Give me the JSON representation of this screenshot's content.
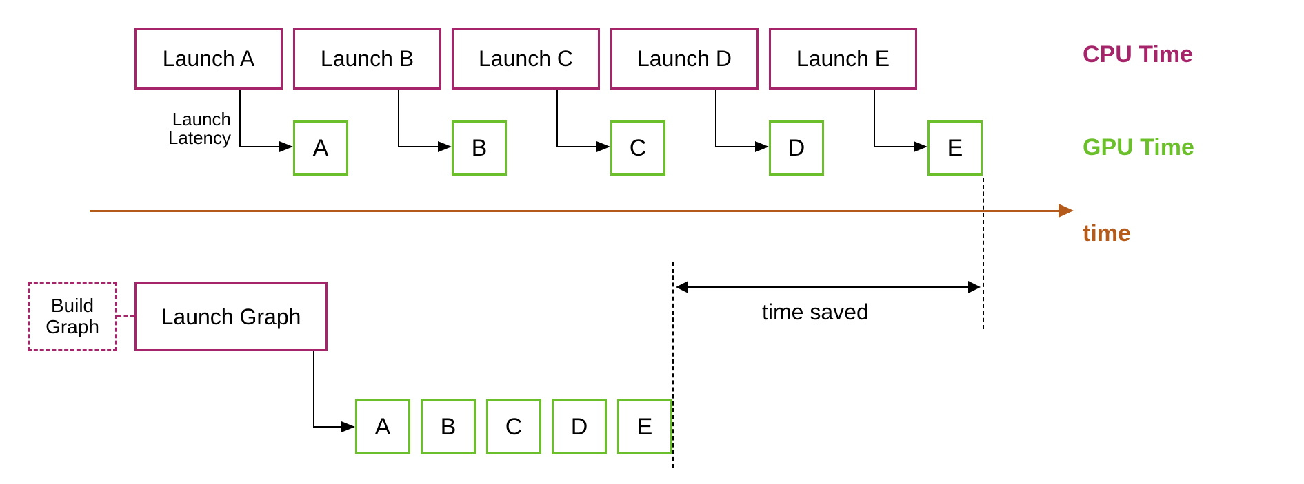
{
  "legend": {
    "cpu": "CPU Time",
    "gpu": "GPU Time",
    "time": "time"
  },
  "labels": {
    "launch_latency_line1": "Launch",
    "launch_latency_line2": "Latency",
    "time_saved": "time saved"
  },
  "top": {
    "cpu_boxes": [
      "Launch A",
      "Launch B",
      "Launch C",
      "Launch D",
      "Launch E"
    ],
    "gpu_boxes": [
      "A",
      "B",
      "C",
      "D",
      "E"
    ]
  },
  "bottom": {
    "build_graph": "Build\nGraph",
    "launch_graph": "Launch Graph",
    "gpu_boxes": [
      "A",
      "B",
      "C",
      "D",
      "E"
    ]
  },
  "colors": {
    "cpu": "#a5246a",
    "gpu": "#6abf2a",
    "time": "#b45a1a"
  }
}
